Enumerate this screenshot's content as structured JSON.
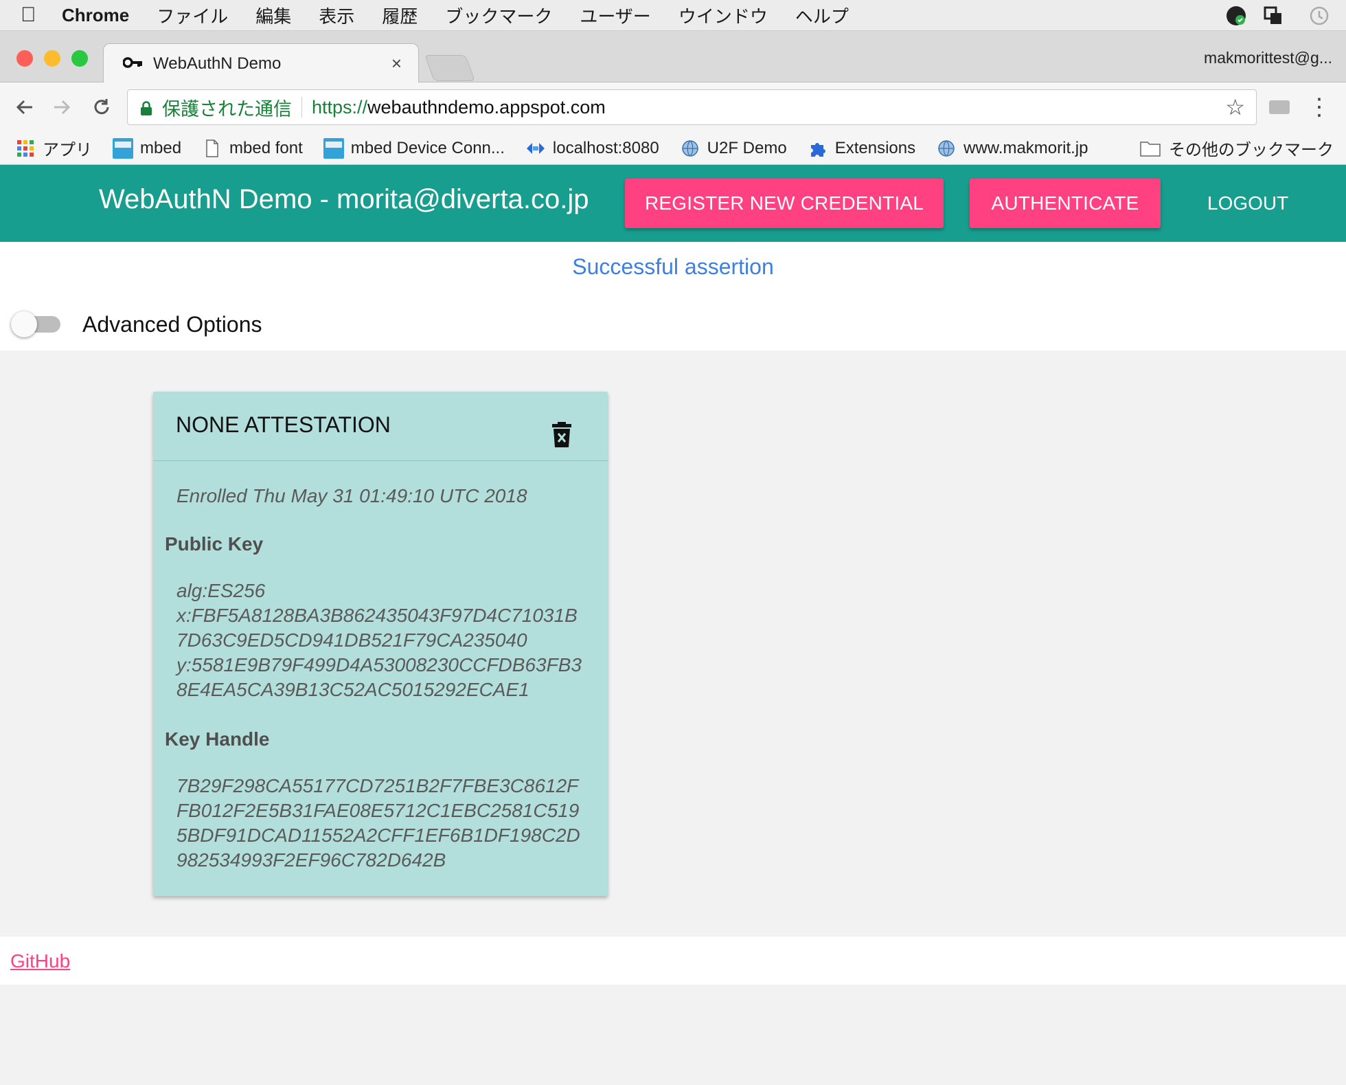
{
  "menubar": {
    "app": "Chrome",
    "items": [
      "ファイル",
      "編集",
      "表示",
      "履歴",
      "ブックマーク",
      "ユーザー",
      "ウインドウ",
      "ヘルプ"
    ]
  },
  "tab": {
    "title": "WebAuthN Demo",
    "close": "×"
  },
  "profile": "makmorittest@g...",
  "omnibox": {
    "secure_label": "保護された通信",
    "scheme": "https://",
    "host": "webauthndemo.appspot.com"
  },
  "bookmarks": {
    "items": [
      "アプリ",
      "mbed",
      "mbed font",
      "mbed Device Conn...",
      "localhost:8080",
      "U2F Demo",
      "Extensions",
      "www.makmorit.jp"
    ],
    "other": "その他のブックマーク"
  },
  "appbar": {
    "title": "WebAuthN Demo - morita@diverta.co.jp",
    "register": "REGISTER NEW CREDENTIAL",
    "authenticate": "AUTHENTICATE",
    "logout": "LOGOUT",
    "color": "#179e8f",
    "accent": "#ff4081"
  },
  "status": "Successful assertion",
  "advanced_options": {
    "label": "Advanced Options",
    "enabled": false
  },
  "card": {
    "title": "NONE ATTESTATION",
    "enrolled": "Enrolled Thu May 31 01:49:10 UTC 2018",
    "public_key_label": "Public Key",
    "public_key_lines": [
      "alg:ES256",
      "x:FBF5A8128BA3B862435043F97D4C71031B",
      "7D63C9ED5CD941DB521F79CA235040",
      "y:5581E9B79F499D4A53008230CCFDB63FB3",
      "8E4EA5CA39B13C52AC5015292ECAE1"
    ],
    "key_handle_label": "Key Handle",
    "key_handle_lines": [
      "7B29F298CA55177CD7251B2F7FBE3C8612F",
      "FB012F2E5B31FAE08E5712C1EBC2581C519",
      "5BDF91DCAD11552A2CFF1EF6B1DF198C2D",
      "982534993F2EF96C782D642B"
    ],
    "bg": "#b2dfdb"
  },
  "footer": {
    "link": "GitHub"
  }
}
